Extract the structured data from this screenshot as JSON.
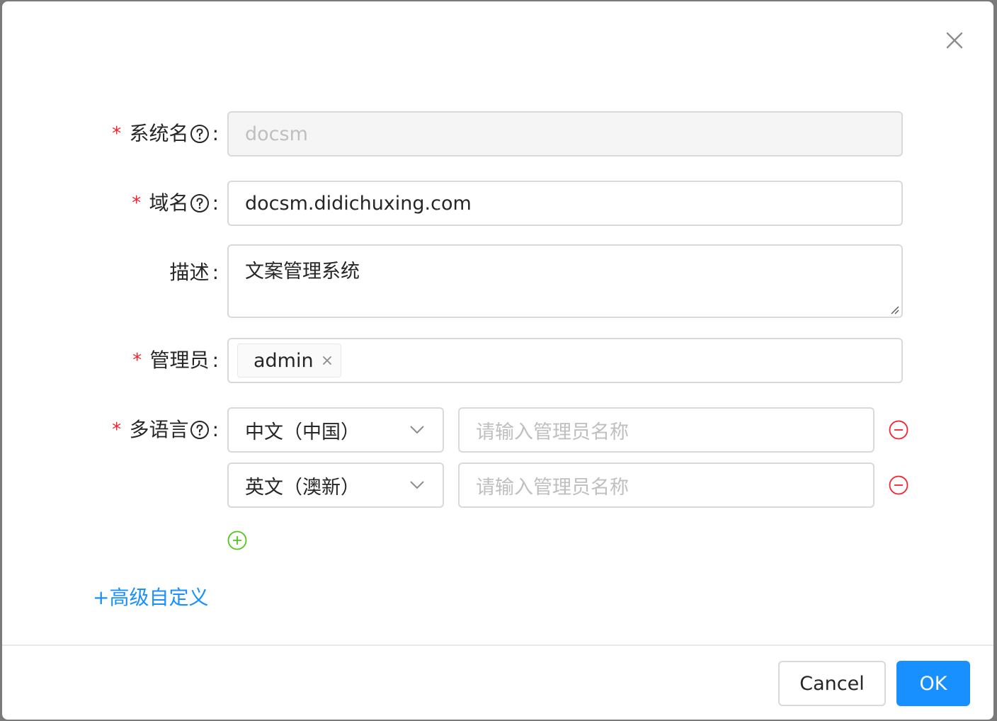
{
  "modal": {
    "fields": {
      "system_name": {
        "label": "系统名",
        "colon": ":",
        "value": "docsm"
      },
      "domain": {
        "label": "域名",
        "colon": ":",
        "value": "docsm.didichuxing.com"
      },
      "description": {
        "label": "描述",
        "colon": ":",
        "value": "文案管理系统"
      },
      "admins": {
        "label": "管理员",
        "colon": ":",
        "tags": [
          "admin"
        ]
      },
      "languages": {
        "label": "多语言",
        "colon": ":",
        "rows": [
          {
            "language": "中文（中国）",
            "placeholder": "请输入管理员名称"
          },
          {
            "language": "英文（澳新）",
            "placeholder": "请输入管理员名称"
          }
        ]
      }
    },
    "required_mark": "*",
    "advanced_link": "+高级自定义",
    "footer": {
      "cancel_label": "Cancel",
      "ok_label": "OK"
    },
    "icons": {
      "close": "close-icon",
      "help": "question-circle-icon",
      "remove": "minus-circle-icon",
      "add": "plus-circle-icon",
      "arrow": "chevron-down-icon"
    },
    "colors": {
      "primary": "#1890ff",
      "required": "#f5222d",
      "remove": "#f5222d",
      "add": "#52c41a"
    }
  }
}
